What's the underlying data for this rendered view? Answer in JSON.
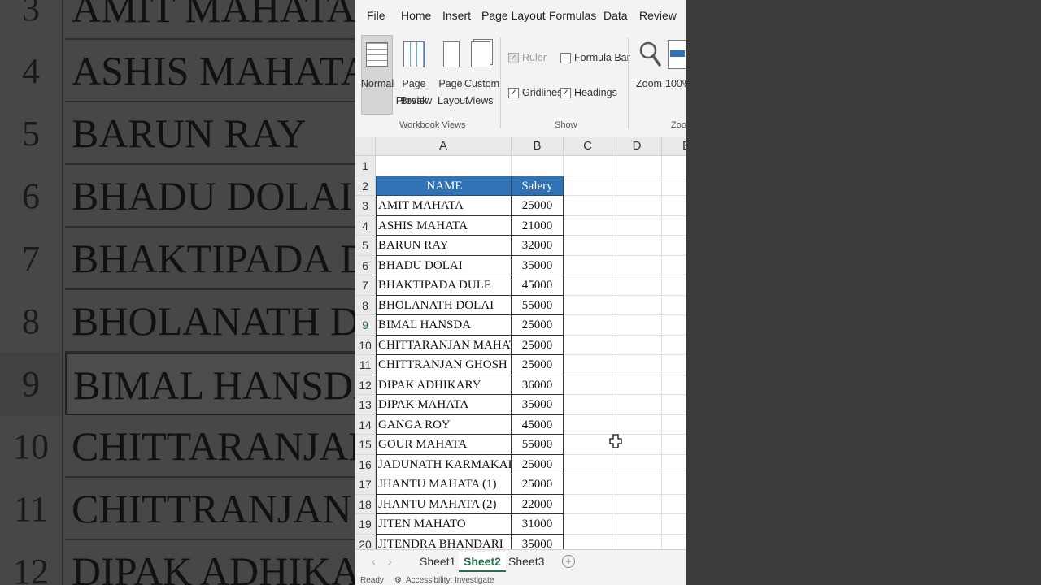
{
  "menu": [
    "File",
    "Home",
    "Insert",
    "Page Layout",
    "Formulas",
    "Data",
    "Review"
  ],
  "ribbon": {
    "normal": "Normal",
    "page_break_1": "Page Break",
    "page_break_2": "Preview",
    "page_layout_1": "Page",
    "page_layout_2": "Layout",
    "custom_1": "Custom",
    "custom_2": "Views",
    "workbook_views": "Workbook Views",
    "ruler": "Ruler",
    "formula_bar": "Formula Bar",
    "gridlines": "Gridlines",
    "headings": "Headings",
    "show": "Show",
    "zoom": "Zoom",
    "zoom_100": "100%",
    "zoom_group": "Zoo"
  },
  "columns": [
    "A",
    "B",
    "C",
    "D",
    "E"
  ],
  "header": {
    "name": "NAME",
    "salary": "Salery"
  },
  "rows": [
    {
      "n": "1",
      "name": "",
      "salary": ""
    },
    {
      "n": "2",
      "name": "NAME",
      "salary": "Salery"
    },
    {
      "n": "3",
      "name": "AMIT MAHATA",
      "salary": "25000"
    },
    {
      "n": "4",
      "name": "ASHIS MAHATA",
      "salary": "21000"
    },
    {
      "n": "5",
      "name": "BARUN RAY",
      "salary": "32000"
    },
    {
      "n": "6",
      "name": "BHADU DOLAI",
      "salary": "35000"
    },
    {
      "n": "7",
      "name": "BHAKTIPADA DULE",
      "salary": "45000"
    },
    {
      "n": "8",
      "name": "BHOLANATH DOLAI",
      "salary": "55000"
    },
    {
      "n": "9",
      "name": "BIMAL HANSDA",
      "salary": "25000"
    },
    {
      "n": "10",
      "name": "CHITTARANJAN MAHATA",
      "salary": "25000"
    },
    {
      "n": "11",
      "name": "CHITTRANJAN GHOSH",
      "salary": "25000"
    },
    {
      "n": "12",
      "name": "DIPAK ADHIKARY",
      "salary": "36000"
    },
    {
      "n": "13",
      "name": "DIPAK MAHATA",
      "salary": "35000"
    },
    {
      "n": "14",
      "name": "GANGA ROY",
      "salary": "45000"
    },
    {
      "n": "15",
      "name": "GOUR MAHATA",
      "salary": "55000"
    },
    {
      "n": "16",
      "name": "JADUNATH KARMAKAR",
      "salary": "25000"
    },
    {
      "n": "17",
      "name": "JHANTU MAHATA (1)",
      "salary": "25000"
    },
    {
      "n": "18",
      "name": "JHANTU MAHATA (2)",
      "salary": "22000"
    },
    {
      "n": "19",
      "name": "JITEN MAHATO",
      "salary": "31000"
    },
    {
      "n": "20",
      "name": "JITENDRA BHANDARI",
      "salary": "35000"
    }
  ],
  "active_row": "9",
  "tabs": [
    "Sheet1",
    "Sheet2",
    "Sheet3"
  ],
  "active_tab": "Sheet2",
  "status": {
    "ready": "Ready",
    "accessibility": "Accessibility: Investigate"
  },
  "background": [
    {
      "n": "3",
      "name": "AMIT MAHATA"
    },
    {
      "n": "4",
      "name": "ASHIS MAHATA"
    },
    {
      "n": "5",
      "name": "BARUN RAY"
    },
    {
      "n": "6",
      "name": "BHADU DOLAI"
    },
    {
      "n": "7",
      "name": "BHAKTIPADA DUL"
    },
    {
      "n": "8",
      "name": "BHOLANATH DOLA"
    },
    {
      "n": "9",
      "name": "BIMAL HANSDA"
    },
    {
      "n": "10",
      "name": "CHITTARANJAN M"
    },
    {
      "n": "11",
      "name": "CHITTRANJAN GH"
    },
    {
      "n": "12",
      "name": "DIPAK ADHIKARY"
    }
  ],
  "colors": {
    "header_fill": "#2f73b6",
    "accent": "#217346"
  }
}
